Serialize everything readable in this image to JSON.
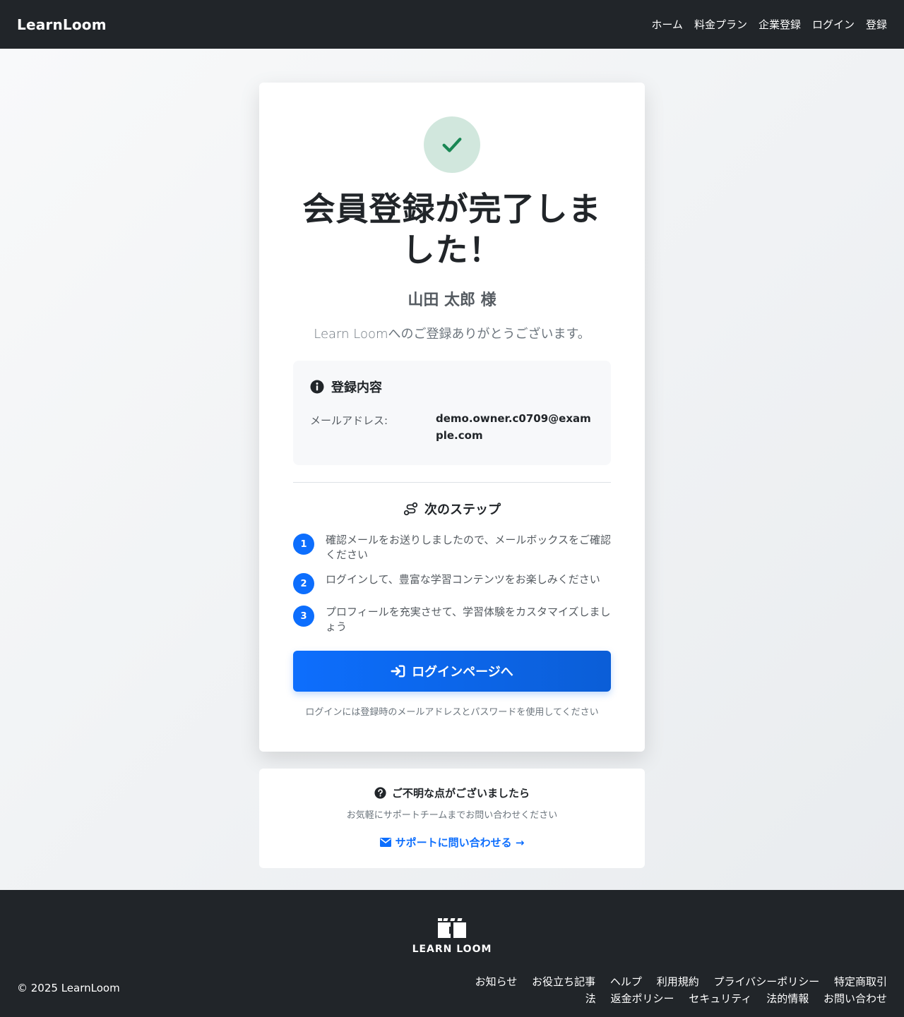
{
  "header": {
    "brand": "LearnLoom",
    "nav": [
      "ホーム",
      "料金プラン",
      "企業登録",
      "ログイン",
      "登録"
    ]
  },
  "card": {
    "title": "会員登録が完了しました！",
    "name": "山田 太郎 様",
    "thanks": "Learn Loomへのご登録ありがとうございます。",
    "info_title": "登録内容",
    "email_label": "メールアドレス:",
    "email_value": "demo.owner.c0709@example.com",
    "steps_title": "次のステップ",
    "steps": [
      {
        "num": "1",
        "text": "確認メールをお送りしましたので、メールボックスをご確認ください"
      },
      {
        "num": "2",
        "text": "ログインして、豊富な学習コンテンツをお楽しみください"
      },
      {
        "num": "3",
        "text": "プロフィールを充実させて、学習体験をカスタマイズしましょう"
      }
    ],
    "login_button": "ログインページへ",
    "login_hint": "ログインには登録時のメールアドレスとパスワードを使用してください"
  },
  "support": {
    "title": "ご不明な点がございましたら",
    "subtitle": "お気軽にサポートチームまでお問い合わせください",
    "link": "サポートに問い合わせる →"
  },
  "footer": {
    "logo_text": "LEARN LOOM",
    "copyright": "© 2025 LearnLoom",
    "links": [
      "お知らせ",
      "お役立ち記事",
      "ヘルプ",
      "利用規約",
      "プライバシーポリシー",
      "特定商取引法",
      "返金ポリシー",
      "セキュリティ",
      "法的情報",
      "お問い合わせ"
    ]
  },
  "colors": {
    "primary": "#0d6efd",
    "success": "#198754",
    "success_bg": "#d1e7dd",
    "dark": "#212529"
  },
  "icons": [
    "check-icon",
    "info-icon",
    "route-icon",
    "login-icon",
    "question-icon",
    "envelope-icon"
  ]
}
